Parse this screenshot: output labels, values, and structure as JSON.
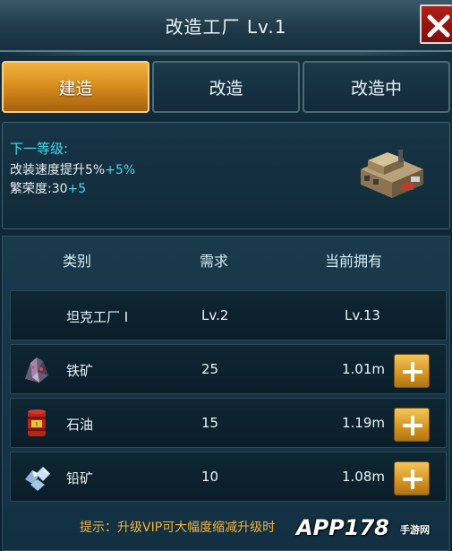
{
  "header": {
    "title": "改造工厂 Lv.1"
  },
  "tabs": [
    {
      "label": "建造",
      "active": true
    },
    {
      "label": "改造",
      "active": false
    },
    {
      "label": "改造中",
      "active": false
    }
  ],
  "next_level": {
    "title": "下一等级:",
    "line1_text": "改装速度提升5%",
    "line1_bonus": "+5%",
    "line2_text": "繁荣度:30",
    "line2_bonus": "+5"
  },
  "table": {
    "headers": [
      "类别",
      "需求",
      "当前拥有"
    ],
    "rows": [
      {
        "icon": "none",
        "name": "坦克工厂 I",
        "need": "Lv.2",
        "have": "Lv.13",
        "add_button": false
      },
      {
        "icon": "iron-ore-icon",
        "name": "铁矿",
        "need": "25",
        "have": "1.01m",
        "add_button": true
      },
      {
        "icon": "oil-barrel-icon",
        "name": "石油",
        "need": "15",
        "have": "1.19m",
        "add_button": true
      },
      {
        "icon": "lead-ore-icon",
        "name": "铅矿",
        "need": "10",
        "have": "1.08m",
        "add_button": true
      }
    ]
  },
  "tip": "提示：升级VIP可大幅度缩减升级时",
  "watermark": {
    "main": "APP178",
    "sub": "手游网"
  },
  "colors": {
    "accent_cyan": "#46d9ef",
    "tab_active": "#e6a12c",
    "close_red": "#a01a15",
    "tip_orange": "#f3b23d"
  }
}
